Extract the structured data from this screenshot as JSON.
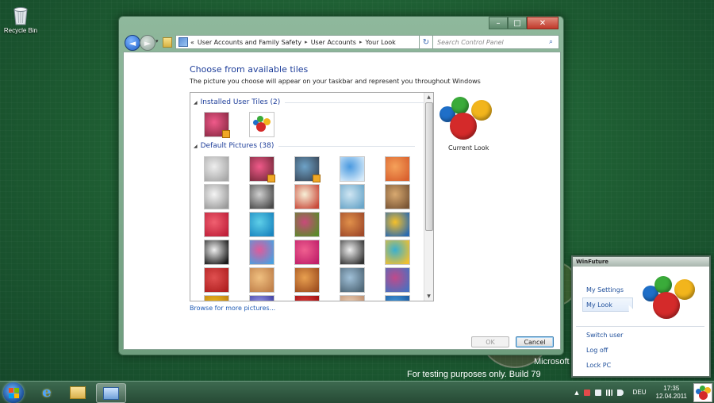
{
  "desktop": {
    "recycle_bin_label": "Recycle Bin",
    "watermark_line1": "Microsoft",
    "watermark_line2": "For testing purposes only. Build 79"
  },
  "window": {
    "controls": {
      "minimize": "–",
      "maximize": "□",
      "close": "✕"
    },
    "nav": {
      "back": "◄",
      "forward": "►",
      "history_dropdown": "▾"
    },
    "address": {
      "overflow": "«",
      "crumbs": [
        "User Accounts and Family Safety",
        "User Accounts",
        "Your Look"
      ],
      "separator": "▸",
      "dropdown": "▾"
    },
    "refresh": "↻",
    "search": {
      "placeholder": "Search Control Panel",
      "icon": "search-icon",
      "glyph": "⌕"
    },
    "heading": "Choose from available tiles",
    "subtext": "The picture you choose will appear on your taskbar and represent you throughout Windows",
    "groups": [
      {
        "label": "Installed User Tiles (2)"
      },
      {
        "label": "Default Pictures (38)"
      }
    ],
    "group_toggle": "◢",
    "installed_tiles": [
      {
        "name": "pink-flower",
        "colors": [
          "#f05a8a",
          "#8d2a45"
        ],
        "badge": true
      },
      {
        "name": "winfuture-logo",
        "colors": [
          "#ffffff",
          "#ffffff"
        ],
        "badge": false
      }
    ],
    "default_tiles": [
      {
        "name": "default-user",
        "colors": [
          "#eeeeee",
          "#a8a8a8"
        ],
        "badge": false
      },
      {
        "name": "flower",
        "colors": [
          "#f05a8a",
          "#7b2a3d"
        ],
        "badge": true
      },
      {
        "name": "landscape",
        "colors": [
          "#6ea3c8",
          "#3a4a5c"
        ],
        "badge": true
      },
      {
        "name": "rollercoaster",
        "colors": [
          "#4a9ae0",
          "#d6eaf9"
        ],
        "badge": false
      },
      {
        "name": "starfish",
        "colors": [
          "#f5a15a",
          "#d9612e"
        ],
        "badge": false
      },
      {
        "name": "robot",
        "colors": [
          "#f5f5f5",
          "#9a9a9a"
        ],
        "badge": false
      },
      {
        "name": "turntable",
        "colors": [
          "#d0d0d0",
          "#4a4a4a"
        ],
        "badge": false
      },
      {
        "name": "lucky-cat",
        "colors": [
          "#f7f0d8",
          "#c94a3a"
        ],
        "badge": false
      },
      {
        "name": "astronaut",
        "colors": [
          "#cfe6f3",
          "#6aa6c9"
        ],
        "badge": false
      },
      {
        "name": "kitten",
        "colors": [
          "#d8a970",
          "#7a5636"
        ],
        "badge": false
      },
      {
        "name": "red-flower",
        "colors": [
          "#f06070",
          "#c0203a"
        ],
        "badge": false
      },
      {
        "name": "umbrella",
        "colors": [
          "#5ecfe8",
          "#1a86c0"
        ],
        "badge": false
      },
      {
        "name": "ball",
        "colors": [
          "#c94a7a",
          "#5a8a2a"
        ],
        "badge": false
      },
      {
        "name": "blocks",
        "colors": [
          "#e0904a",
          "#a04a2a"
        ],
        "badge": false
      },
      {
        "name": "leaf",
        "colors": [
          "#f5c02a",
          "#2a6ab0"
        ],
        "badge": false
      },
      {
        "name": "dog",
        "colors": [
          "#f0f0f0",
          "#1a1a1a"
        ],
        "badge": false
      },
      {
        "name": "pencils",
        "colors": [
          "#e05a9a",
          "#4aa0e0"
        ],
        "badge": false
      },
      {
        "name": "pink-star",
        "colors": [
          "#f06090",
          "#c0206a"
        ],
        "badge": false
      },
      {
        "name": "chess",
        "colors": [
          "#eeeeee",
          "#333333"
        ],
        "badge": false
      },
      {
        "name": "stairs",
        "colors": [
          "#3ab0d0",
          "#f0c030"
        ],
        "badge": false
      },
      {
        "name": "crane",
        "colors": [
          "#e05050",
          "#b02020"
        ],
        "badge": false
      },
      {
        "name": "sand",
        "colors": [
          "#f0c080",
          "#c0804a"
        ],
        "badge": false
      },
      {
        "name": "pomeranian",
        "colors": [
          "#e8a050",
          "#a05020"
        ],
        "badge": false
      },
      {
        "name": "toy-robot",
        "colors": [
          "#a0c0d8",
          "#506878"
        ],
        "badge": false
      },
      {
        "name": "shells",
        "colors": [
          "#c04a8a",
          "#4a70c0"
        ],
        "badge": false
      },
      {
        "name": "sunflower",
        "colors": [
          "#f0c020",
          "#c08010"
        ],
        "badge": false
      },
      {
        "name": "jellyfish",
        "colors": [
          "#a0a0f0",
          "#4040a0"
        ],
        "badge": false
      },
      {
        "name": "apple",
        "colors": [
          "#e04040",
          "#a01010"
        ],
        "badge": false
      },
      {
        "name": "sunset",
        "colors": [
          "#f0d8c0",
          "#c09070"
        ],
        "badge": false
      },
      {
        "name": "beach",
        "colors": [
          "#4aa0e0",
          "#1a5aa0"
        ],
        "badge": false
      }
    ],
    "browse_link": "Browse for more pictures...",
    "current_look_label": "Current Look",
    "ok_label": "OK",
    "cancel_label": "Cancel",
    "scroll_up": "▲",
    "scroll_down": "▼"
  },
  "gadget": {
    "title": "WinFuture",
    "items": [
      "My Settings",
      "My Look",
      "Switch user",
      "Log off",
      "Lock PC"
    ],
    "selected": "My Look"
  },
  "logo_colors": {
    "red": "#d42a2a",
    "green": "#3aab3a",
    "yellow": "#f2b51c",
    "blue": "#1f6fc8"
  },
  "taskbar": {
    "language": "DEU",
    "time": "17:35",
    "date": "12.04.2011",
    "ie_glyph": "e",
    "tray_expand": "▲"
  }
}
